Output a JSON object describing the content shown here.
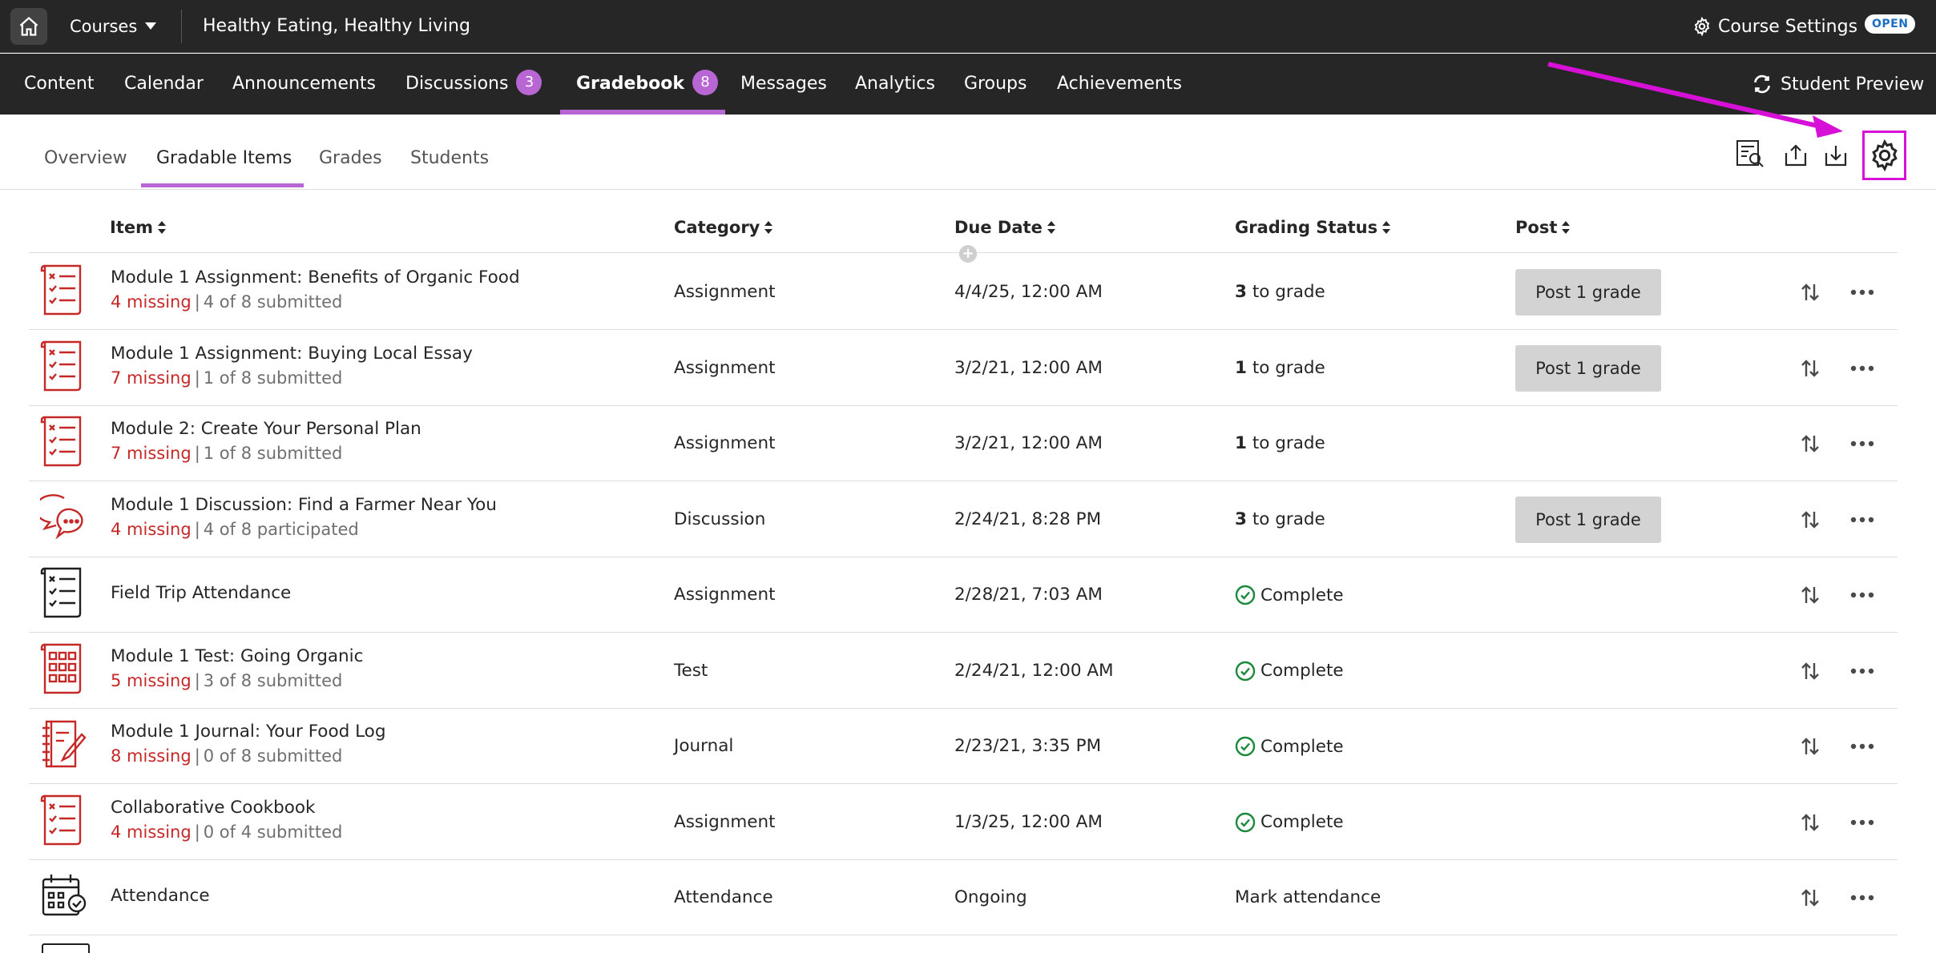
{
  "topbar": {
    "courses_label": "Courses",
    "course_title": "Healthy Eating, Healthy Living",
    "course_settings_label": "Course Settings",
    "open_badge": "OPEN"
  },
  "nav": {
    "items": [
      {
        "label": "Content"
      },
      {
        "label": "Calendar"
      },
      {
        "label": "Announcements"
      },
      {
        "label": "Discussions",
        "badge": "3"
      },
      {
        "label": "Gradebook",
        "badge": "8",
        "active": true
      },
      {
        "label": "Messages"
      },
      {
        "label": "Analytics"
      },
      {
        "label": "Groups"
      },
      {
        "label": "Achievements"
      }
    ],
    "student_preview": "Student Preview"
  },
  "subtabs": {
    "items": [
      {
        "label": "Overview"
      },
      {
        "label": "Gradable Items",
        "active": true
      },
      {
        "label": "Grades"
      },
      {
        "label": "Students"
      }
    ]
  },
  "table": {
    "headers": {
      "item": "Item",
      "category": "Category",
      "due_date": "Due Date",
      "grading_status": "Grading Status",
      "post": "Post"
    },
    "rows": [
      {
        "icon": "assignment-icon",
        "title": "Module 1 Assignment: Benefits of Organic Food",
        "missing": "4 missing",
        "submitted": "4 of 8 submitted",
        "category": "Assignment",
        "due": "4/4/25, 12:00 AM",
        "status_count": "3",
        "status_text": "to grade",
        "post": "Post 1 grade"
      },
      {
        "icon": "assignment-icon",
        "title": "Module 1 Assignment: Buying Local Essay",
        "missing": "7 missing",
        "submitted": "1 of 8 submitted",
        "category": "Assignment",
        "due": "3/2/21, 12:00 AM",
        "status_count": "1",
        "status_text": "to grade",
        "post": "Post 1 grade"
      },
      {
        "icon": "assignment-icon",
        "title": "Module 2: Create Your Personal Plan",
        "missing": "7 missing",
        "submitted": "1 of 8 submitted",
        "category": "Assignment",
        "due": "3/2/21, 12:00 AM",
        "status_count": "1",
        "status_text": "to grade",
        "post": ""
      },
      {
        "icon": "discussion-icon",
        "title": "Module 1 Discussion: Find a Farmer Near You",
        "missing": "4 missing",
        "submitted": "4 of 8 participated",
        "category": "Discussion",
        "due": "2/24/21, 8:28 PM",
        "status_count": "3",
        "status_text": "to grade",
        "post": "Post 1 grade"
      },
      {
        "icon": "assignment-icon",
        "title": "Field Trip Attendance",
        "missing": "",
        "submitted": "",
        "category": "Assignment",
        "due": "2/28/21, 7:03 AM",
        "status_complete": "Complete",
        "post": ""
      },
      {
        "icon": "test-icon",
        "title": "Module 1 Test: Going Organic",
        "missing": "5 missing",
        "submitted": "3 of 8 submitted",
        "category": "Test",
        "due": "2/24/21, 12:00 AM",
        "status_complete": "Complete",
        "post": ""
      },
      {
        "icon": "journal-icon",
        "title": "Module 1 Journal: Your Food Log",
        "missing": "8 missing",
        "submitted": "0 of 8 submitted",
        "category": "Journal",
        "due": "2/23/21, 3:35 PM",
        "status_complete": "Complete",
        "post": ""
      },
      {
        "icon": "assignment-icon",
        "title": "Collaborative Cookbook",
        "missing": "4 missing",
        "submitted": "0 of 4 submitted",
        "category": "Assignment",
        "due": "1/3/25, 12:00 AM",
        "status_complete": "Complete",
        "post": ""
      },
      {
        "icon": "attendance-icon",
        "title": "Attendance",
        "missing": "",
        "submitted": "",
        "category": "Attendance",
        "due": "Ongoing",
        "status_plain": "Mark attendance",
        "post": ""
      }
    ]
  },
  "colors": {
    "accent_purple": "#b866d4",
    "annotation_magenta": "#d610d6",
    "missing_red": "#c62828",
    "complete_green": "#1a8a3a",
    "topbar_bg": "#262626"
  }
}
